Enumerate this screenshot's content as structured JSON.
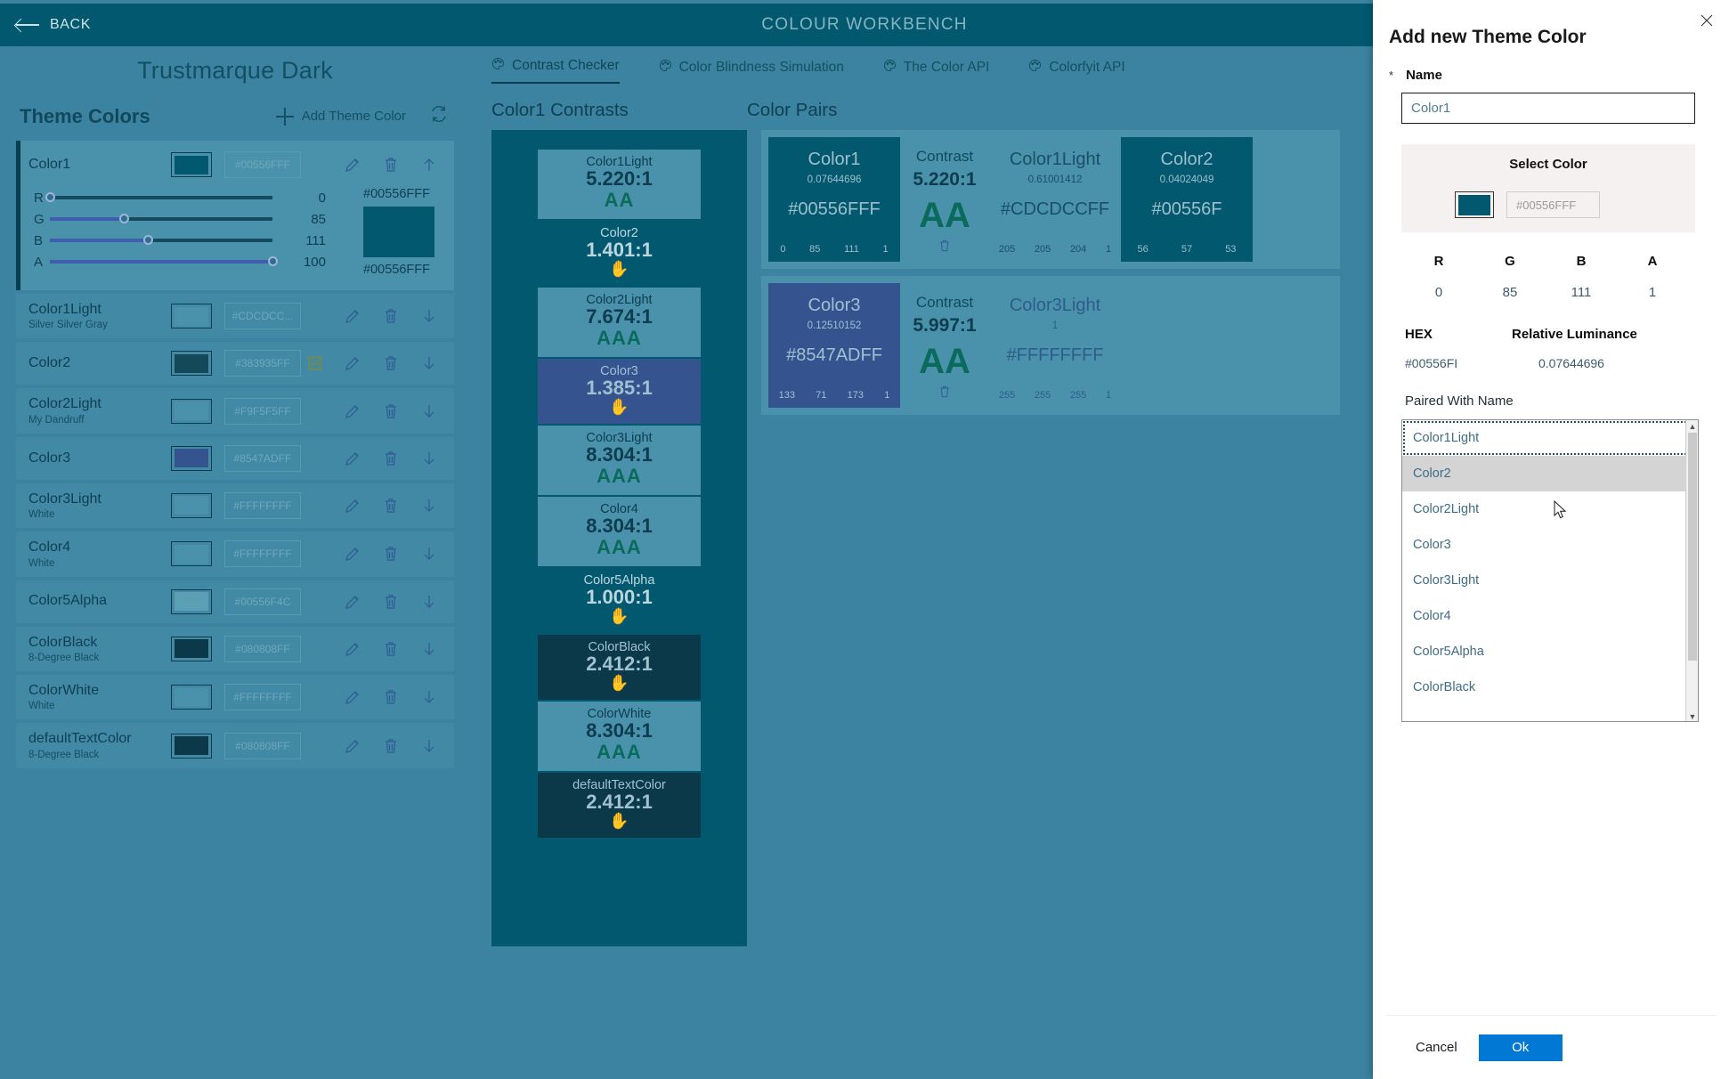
{
  "topbar": {
    "back_label": "BACK",
    "app_title": "COLOUR WORKBENCH"
  },
  "left": {
    "theme_name": "Trustmarque Dark",
    "theme_colors_title": "Theme Colors",
    "add_theme_color_label": "Add Theme Color",
    "selected": {
      "name": "Color1",
      "hex_placeholder": "#00556FFF",
      "swatch": "#02596f",
      "sliders": [
        {
          "label": "R",
          "value": "0",
          "pct": 0
        },
        {
          "label": "G",
          "value": "85",
          "pct": 33
        },
        {
          "label": "B",
          "value": "111",
          "pct": 44
        },
        {
          "label": "A",
          "value": "100",
          "pct": 100
        }
      ],
      "hex_top": "#00556FFF",
      "hex_bottom": "#00556FFF",
      "big_swatch": "#02596f"
    },
    "rows": [
      {
        "name": "Color1Light",
        "sub": "Silver Silver Gray",
        "hex": "#CDCDCC...",
        "swatch": "#4a92ab",
        "has_save": false
      },
      {
        "name": "Color2",
        "sub": "",
        "hex": "#383935FF",
        "swatch": "#14495a",
        "has_save": true
      },
      {
        "name": "Color2Light",
        "sub": "My Dandruff",
        "hex": "#F9F5F5FF",
        "swatch": "#4a92ab",
        "has_save": false
      },
      {
        "name": "Color3",
        "sub": "",
        "hex": "#8547ADFF",
        "swatch": "#34538f",
        "has_save": false
      },
      {
        "name": "Color3Light",
        "sub": "White",
        "hex": "#FFFFFFFF",
        "swatch": "#4a92ab",
        "has_save": false
      },
      {
        "name": "Color4",
        "sub": "White",
        "hex": "#FFFFFFFF",
        "swatch": "#4a92ab",
        "has_save": false
      },
      {
        "name": "Color5Alpha",
        "sub": "",
        "hex": "#00556F4C",
        "swatch": "#5b9fb5",
        "has_save": false
      },
      {
        "name": "ColorBlack",
        "sub": "8-Degree Black",
        "hex": "#080808FF",
        "swatch": "#0b3949",
        "has_save": false
      },
      {
        "name": "ColorWhite",
        "sub": "White",
        "hex": "#FFFFFFFF",
        "swatch": "#4a92ab",
        "has_save": false
      },
      {
        "name": "defaultTextColor",
        "sub": "8-Degree Black",
        "hex": "#080808FF",
        "swatch": "#0b3949",
        "has_save": false
      }
    ]
  },
  "main": {
    "tabs": [
      {
        "label": "Contrast Checker",
        "active": true
      },
      {
        "label": "Color Blindness Simulation",
        "active": false
      },
      {
        "label": "The Color API",
        "active": false
      },
      {
        "label": "Colorfyit API",
        "active": false
      }
    ],
    "contrasts_title": "Color1 Contrasts",
    "pairs_title": "Color Pairs",
    "contrasts": [
      {
        "name": "Color1Light",
        "ratio": "5.220:1",
        "badge": "AA",
        "pass": true,
        "bg": "#4a92ab",
        "fg": "#0d3c4f"
      },
      {
        "name": "Color2",
        "ratio": "1.401:1",
        "badge": "",
        "pass": false,
        "bg": "#02596f",
        "fg": "#bcd6de"
      },
      {
        "name": "Color2Light",
        "ratio": "7.674:1",
        "badge": "AAA",
        "pass": true,
        "bg": "#4a92ab",
        "fg": "#0d3c4f"
      },
      {
        "name": "Color3",
        "ratio": "1.385:1",
        "badge": "",
        "pass": false,
        "bg": "#34538f",
        "fg": "#9fc1d0"
      },
      {
        "name": "Color3Light",
        "ratio": "8.304:1",
        "badge": "AAA",
        "pass": true,
        "bg": "#4a92ab",
        "fg": "#0d3c4f"
      },
      {
        "name": "Color4",
        "ratio": "8.304:1",
        "badge": "AAA",
        "pass": true,
        "bg": "#4a92ab",
        "fg": "#0d3c4f"
      },
      {
        "name": "Color5Alpha",
        "ratio": "1.000:1",
        "badge": "",
        "pass": false,
        "bg": "#02596f",
        "fg": "#bcd6de"
      },
      {
        "name": "ColorBlack",
        "ratio": "2.412:1",
        "badge": "",
        "pass": false,
        "bg": "#0b3949",
        "fg": "#9fc1d0"
      },
      {
        "name": "ColorWhite",
        "ratio": "8.304:1",
        "badge": "AAA",
        "pass": true,
        "bg": "#4a92ab",
        "fg": "#0d3c4f"
      },
      {
        "name": "defaultTextColor",
        "ratio": "2.412:1",
        "badge": "",
        "pass": false,
        "bg": "#0b3949",
        "fg": "#9fc1d0"
      }
    ],
    "contrast_label": "Contrast",
    "pairs": [
      {
        "contrast": "5.220:1",
        "badge": "AA",
        "a": {
          "name": "Color1",
          "lum": "0.07644696",
          "hex": "#00556FFF",
          "rgba": [
            "0",
            "85",
            "111",
            "1"
          ],
          "bg": "#02596f",
          "fg": "#9dbfcc"
        },
        "b": {
          "name": "Color1Light",
          "lum": "0.61001412",
          "hex": "#CDCDCCFF",
          "rgba": [
            "205",
            "205",
            "204",
            "1"
          ],
          "bg": "#4a92ab",
          "fg": "#1a4f66"
        },
        "c": {
          "name": "Color2",
          "lum": "0.04024049",
          "hex": "#00556F",
          "rgba": [
            "56",
            "57",
            "53"
          ],
          "bg": "#02596f",
          "fg": "#9dbfcc"
        }
      },
      {
        "contrast": "5.997:1",
        "badge": "AA",
        "a": {
          "name": "Color3",
          "lum": "0.12510152",
          "hex": "#8547ADFF",
          "rgba": [
            "133",
            "71",
            "173",
            "1"
          ],
          "bg": "#34538f",
          "fg": "#9fc1d0"
        },
        "b": {
          "name": "Color3Light",
          "lum": "1",
          "hex": "#FFFFFFFF",
          "rgba": [
            "255",
            "255",
            "255",
            "1"
          ],
          "bg": "#4a92ab",
          "fg": "#2e5c8c"
        }
      }
    ]
  },
  "dialog": {
    "title": "Add new Theme Color",
    "name_label": "Name",
    "required_mark": "*",
    "name_value": "Color1",
    "select_color_title": "Select Color",
    "select_color_swatch": "#02596f",
    "select_color_hex_placeholder": "#00556FFF",
    "rgba_headers": [
      "R",
      "G",
      "B",
      "A"
    ],
    "rgba_values": [
      "0",
      "85",
      "111",
      "1"
    ],
    "hex_header": "HEX",
    "luminance_header": "Relative Luminance",
    "hex_value": "#00556FI",
    "luminance_value": "0.07644696",
    "paired_with_label": "Paired With Name",
    "paired_options": [
      {
        "label": "Color1Light",
        "state": "focused"
      },
      {
        "label": "Color2",
        "state": "hover"
      },
      {
        "label": "Color2Light",
        "state": ""
      },
      {
        "label": "Color3",
        "state": ""
      },
      {
        "label": "Color3Light",
        "state": ""
      },
      {
        "label": "Color4",
        "state": ""
      },
      {
        "label": "Color5Alpha",
        "state": ""
      },
      {
        "label": "ColorBlack",
        "state": ""
      }
    ],
    "cancel_label": "Cancel",
    "ok_label": "Ok",
    "accent": "#0078d4"
  }
}
